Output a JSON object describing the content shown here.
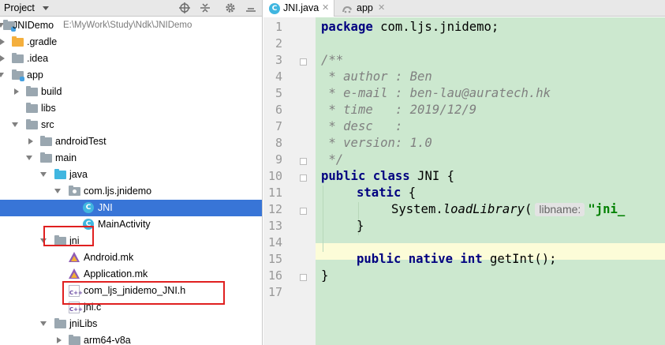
{
  "project_panel": {
    "title": "Project",
    "toolbar_icons": [
      "target-icon",
      "collapse-icon",
      "gear-icon",
      "hide-icon"
    ],
    "tree": [
      {
        "label": "JNIDemo",
        "sublabel": "E:\\MyWork\\Study\\Ndk\\JNIDemo",
        "icon": "module-folder",
        "expanded": true
      },
      {
        "label": ".gradle",
        "icon": "folder-orange",
        "expanded": false
      },
      {
        "label": ".idea",
        "icon": "folder",
        "expanded": false
      },
      {
        "label": "app",
        "icon": "module-folder",
        "expanded": true
      },
      {
        "label": "build",
        "icon": "folder",
        "expanded": false
      },
      {
        "label": "libs",
        "icon": "folder"
      },
      {
        "label": "src",
        "icon": "folder",
        "expanded": true
      },
      {
        "label": "androidTest",
        "icon": "folder",
        "expanded": false
      },
      {
        "label": "main",
        "icon": "folder",
        "expanded": true
      },
      {
        "label": "java",
        "icon": "folder-blue",
        "expanded": true
      },
      {
        "label": "com.ljs.jnidemo",
        "icon": "package",
        "expanded": true
      },
      {
        "label": "JNI",
        "icon": "class",
        "selected": true
      },
      {
        "label": "MainActivity",
        "icon": "class"
      },
      {
        "label": "jni",
        "icon": "folder",
        "expanded": true
      },
      {
        "label": "Android.mk",
        "icon": "mk"
      },
      {
        "label": "Application.mk",
        "icon": "mk"
      },
      {
        "label": "com_ljs_jnidemo_JNI.h",
        "icon": "header"
      },
      {
        "label": "jni.c",
        "icon": "c-source"
      },
      {
        "label": "jniLibs",
        "icon": "folder",
        "expanded": true
      },
      {
        "label": "arm64-v8a",
        "icon": "folder",
        "expanded": false
      }
    ]
  },
  "editor": {
    "tabs": [
      {
        "label": "JNI.java",
        "icon": "class",
        "active": true
      },
      {
        "label": "app",
        "icon": "gradle",
        "active": false
      }
    ],
    "line_numbers": [
      "1",
      "2",
      "3",
      "4",
      "5",
      "6",
      "7",
      "8",
      "9",
      "10",
      "11",
      "12",
      "13",
      "14",
      "15",
      "16",
      "17"
    ],
    "current_line": 14,
    "code": {
      "l1_kw": "package",
      "l1_rest": " com.ljs.jnidemo;",
      "l3": "/**",
      "l4": " * author : Ben",
      "l5": " * e-mail : ben-lau@auratech.hk",
      "l6": " * time   : 2019/12/9",
      "l7": " * desc   :",
      "l8": " * version: 1.0",
      "l9": " */",
      "l10_kw": "public class",
      "l10_rest": " JNI {",
      "l11_kw": "static",
      "l11_rest": " {",
      "l12_a": "System.",
      "l12_method": "loadLibrary",
      "l12_paren": "(",
      "l12_hint": "libname:",
      "l12_str": "\"jni_",
      "l13": "}",
      "l15_kw": "public native int",
      "l15_rest": " getInt();",
      "l16": "}"
    }
  }
}
